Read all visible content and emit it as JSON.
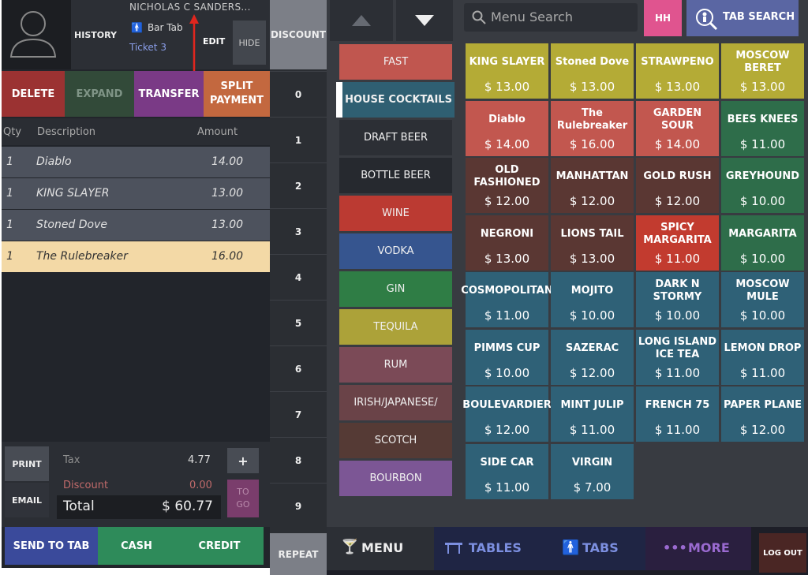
{
  "customer": {
    "name": "NICHOLAS C SANDERS...",
    "tab_type": "Bar Tab",
    "ticket": "Ticket 3"
  },
  "header_buttons": {
    "history": "HISTORY",
    "edit": "EDIT",
    "hide": "HIDE"
  },
  "actions": {
    "delete": "DELETE",
    "expand": "EXPAND",
    "transfer": "TRANSFER",
    "split_line1": "SPLIT",
    "split_line2": "PAYMENT"
  },
  "order_table": {
    "headers": {
      "qty": "Qty",
      "description": "Description",
      "amount": "Amount"
    },
    "rows": [
      {
        "qty": "1",
        "description": "Diablo",
        "amount": "14.00"
      },
      {
        "qty": "1",
        "description": "KING SLAYER",
        "amount": "13.00"
      },
      {
        "qty": "1",
        "description": "Stoned Dove",
        "amount": "13.00"
      },
      {
        "qty": "1",
        "description": "The Rulebreaker",
        "amount": "16.00"
      }
    ]
  },
  "totals": {
    "tax_label": "Tax",
    "tax": "4.77",
    "discount_label": "Discount",
    "discount": "0.00",
    "total_label": "Total",
    "total": "$ 60.77",
    "plus": "+",
    "togo1": "TO",
    "togo2": "GO"
  },
  "side_buttons": {
    "print": "PRINT",
    "email": "EMAIL"
  },
  "payment": {
    "send_to_tab": "SEND TO TAB",
    "cash": "CASH",
    "credit": "CREDIT"
  },
  "keypad": {
    "discount": "DISCOUNT",
    "repeat": "REPEAT",
    "numbers": [
      "0",
      "1",
      "2",
      "3",
      "4",
      "5",
      "6",
      "7",
      "8",
      "9"
    ]
  },
  "categories": [
    {
      "label": "FAST",
      "color": "#c0564f"
    },
    {
      "label": "HOUSE COCKTAILS",
      "color": "#2f5f72"
    },
    {
      "label": "DRAFT BEER",
      "color": "#2c2f35"
    },
    {
      "label": "BOTTLE BEER",
      "color": "#26292f"
    },
    {
      "label": "WINE",
      "color": "#bb3a32"
    },
    {
      "label": "VODKA",
      "color": "#36558f"
    },
    {
      "label": "GIN",
      "color": "#2f7d45"
    },
    {
      "label": "TEQUILA",
      "color": "#aca239"
    },
    {
      "label": "RUM",
      "color": "#7b4a57"
    },
    {
      "label": "IRISH/JAPANESE/",
      "color": "#6a4348"
    },
    {
      "label": "SCOTCH",
      "color": "#553a35"
    },
    {
      "label": "BOURBON",
      "color": "#7c5695"
    }
  ],
  "search": {
    "placeholder": "Menu Search",
    "hh": "HH",
    "tab_search": "TAB SEARCH"
  },
  "menu_items": [
    {
      "name": "KING SLAYER",
      "price": "$ 13.00",
      "color": "#b4ab36"
    },
    {
      "name": "Stoned Dove",
      "price": "$ 13.00",
      "color": "#b4ab36"
    },
    {
      "name": "STRAWPENO",
      "price": "$ 13.00",
      "color": "#b4ab36"
    },
    {
      "name": "MOSCOW BERET",
      "price": "$ 13.00",
      "color": "#b4ab36"
    },
    {
      "name": "Diablo",
      "price": "$ 14.00",
      "color": "#c2574f"
    },
    {
      "name": "The Rulebreaker",
      "price": "$ 16.00",
      "color": "#c2574f"
    },
    {
      "name": "GARDEN SOUR",
      "price": "$ 14.00",
      "color": "#c2574f"
    },
    {
      "name": "BEES KNEES",
      "price": "$ 11.00",
      "color": "#2e6d4a"
    },
    {
      "name": "OLD FASHIONED",
      "price": "$ 12.00",
      "color": "#5a3733"
    },
    {
      "name": "MANHATTAN",
      "price": "$ 12.00",
      "color": "#5a3733"
    },
    {
      "name": "GOLD RUSH",
      "price": "$ 12.00",
      "color": "#5a3733"
    },
    {
      "name": "GREYHOUND",
      "price": "$ 10.00",
      "color": "#2e6d4a"
    },
    {
      "name": "NEGRONI",
      "price": "$ 13.00",
      "color": "#5a3733"
    },
    {
      "name": "LIONS TAIL",
      "price": "$ 13.00",
      "color": "#5a3733"
    },
    {
      "name": "SPICY MARGARITA",
      "price": "$ 11.00",
      "color": "#c23b2f"
    },
    {
      "name": "MARGARITA",
      "price": "$ 10.00",
      "color": "#2e6d4a"
    },
    {
      "name": "COSMOPOLITAN",
      "price": "$ 11.00",
      "color": "#2f6177"
    },
    {
      "name": "MOJITO",
      "price": "$ 10.00",
      "color": "#2f6177"
    },
    {
      "name": "DARK N STORMY",
      "price": "$ 10.00",
      "color": "#2f6177"
    },
    {
      "name": "MOSCOW MULE",
      "price": "$ 10.00",
      "color": "#2f6177"
    },
    {
      "name": "PIMMS CUP",
      "price": "$ 10.00",
      "color": "#2f6177"
    },
    {
      "name": "SAZERAC",
      "price": "$ 12.00",
      "color": "#2f6177"
    },
    {
      "name": "LONG ISLAND ICE TEA",
      "price": "$ 11.00",
      "color": "#2f6177"
    },
    {
      "name": "LEMON DROP",
      "price": "$ 11.00",
      "color": "#2f6177"
    },
    {
      "name": "BOULEVARDIER",
      "price": "$ 12.00",
      "color": "#2f6177"
    },
    {
      "name": "MINT JULIP",
      "price": "$ 11.00",
      "color": "#2f6177"
    },
    {
      "name": "FRENCH 75",
      "price": "$ 11.00",
      "color": "#2f6177"
    },
    {
      "name": "PAPER PLANE",
      "price": "$ 12.00",
      "color": "#2f6177"
    },
    {
      "name": "SIDE CAR",
      "price": "$ 11.00",
      "color": "#2f6177"
    },
    {
      "name": "VIRGIN",
      "price": "$ 7.00",
      "color": "#2f6177"
    }
  ],
  "nav": {
    "menu": "MENU",
    "tables": "TABLES",
    "tabs": "TABS",
    "more": "MORE",
    "logout": "LOG OUT"
  }
}
